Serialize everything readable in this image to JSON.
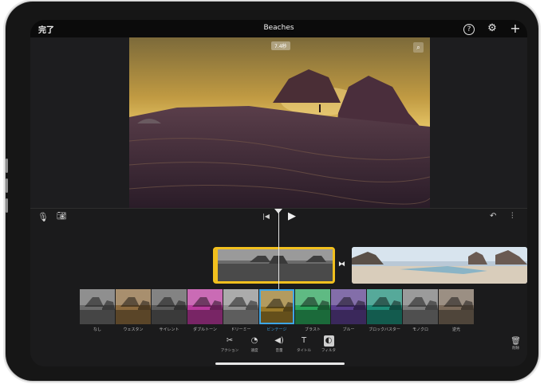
{
  "topbar": {
    "done_label": "完了",
    "title": "Beaches",
    "help_icon": "question-icon",
    "settings_icon": "gear-icon",
    "add_icon": "plus-icon"
  },
  "viewer": {
    "duration_badge": "7.4秒",
    "zoom_icon": "magnify-icon"
  },
  "controls": {
    "mic_icon": "microphone-icon",
    "camera_icon": "camera-icon",
    "skip_back_icon": "skip-back-icon",
    "play_icon": "play-icon",
    "undo_icon": "undo-icon",
    "audio_icon": "waveform-icon"
  },
  "filters": [
    {
      "label": "なし",
      "tint": "#6a6a6a"
    },
    {
      "label": "ウェスタン",
      "tint": "#8b6a3e"
    },
    {
      "label": "サイレント",
      "tint": "#5a5a5a"
    },
    {
      "label": "ダブルトーン",
      "tint": "#b83a9c"
    },
    {
      "label": "ドリーミー",
      "tint": "#8f8f8f"
    },
    {
      "label": "ビンテージ",
      "tint": "#9a7a2a"
    },
    {
      "label": "ブラスト",
      "tint": "#2aa35a"
    },
    {
      "label": "ブルー",
      "tint": "#5a3e8c"
    },
    {
      "label": "ブロックバスター",
      "tint": "#1e8c78"
    },
    {
      "label": "モノクロ",
      "tint": "#7a7a7a"
    },
    {
      "label": "逆光",
      "tint": "#7a6a5a"
    }
  ],
  "selected_filter_index": 5,
  "toolbar": {
    "tools": [
      {
        "label": "アクション",
        "icon": "scissors-icon"
      },
      {
        "label": "速度",
        "icon": "speed-icon"
      },
      {
        "label": "音量",
        "icon": "speaker-icon"
      },
      {
        "label": "タイトル",
        "icon": "text-icon"
      },
      {
        "label": "フィルタ",
        "icon": "filter-icon"
      }
    ],
    "delete_label": "削除",
    "delete_icon": "trash-icon"
  },
  "colors": {
    "accent": "#3ea6e6",
    "selection": "#f2c01e"
  }
}
